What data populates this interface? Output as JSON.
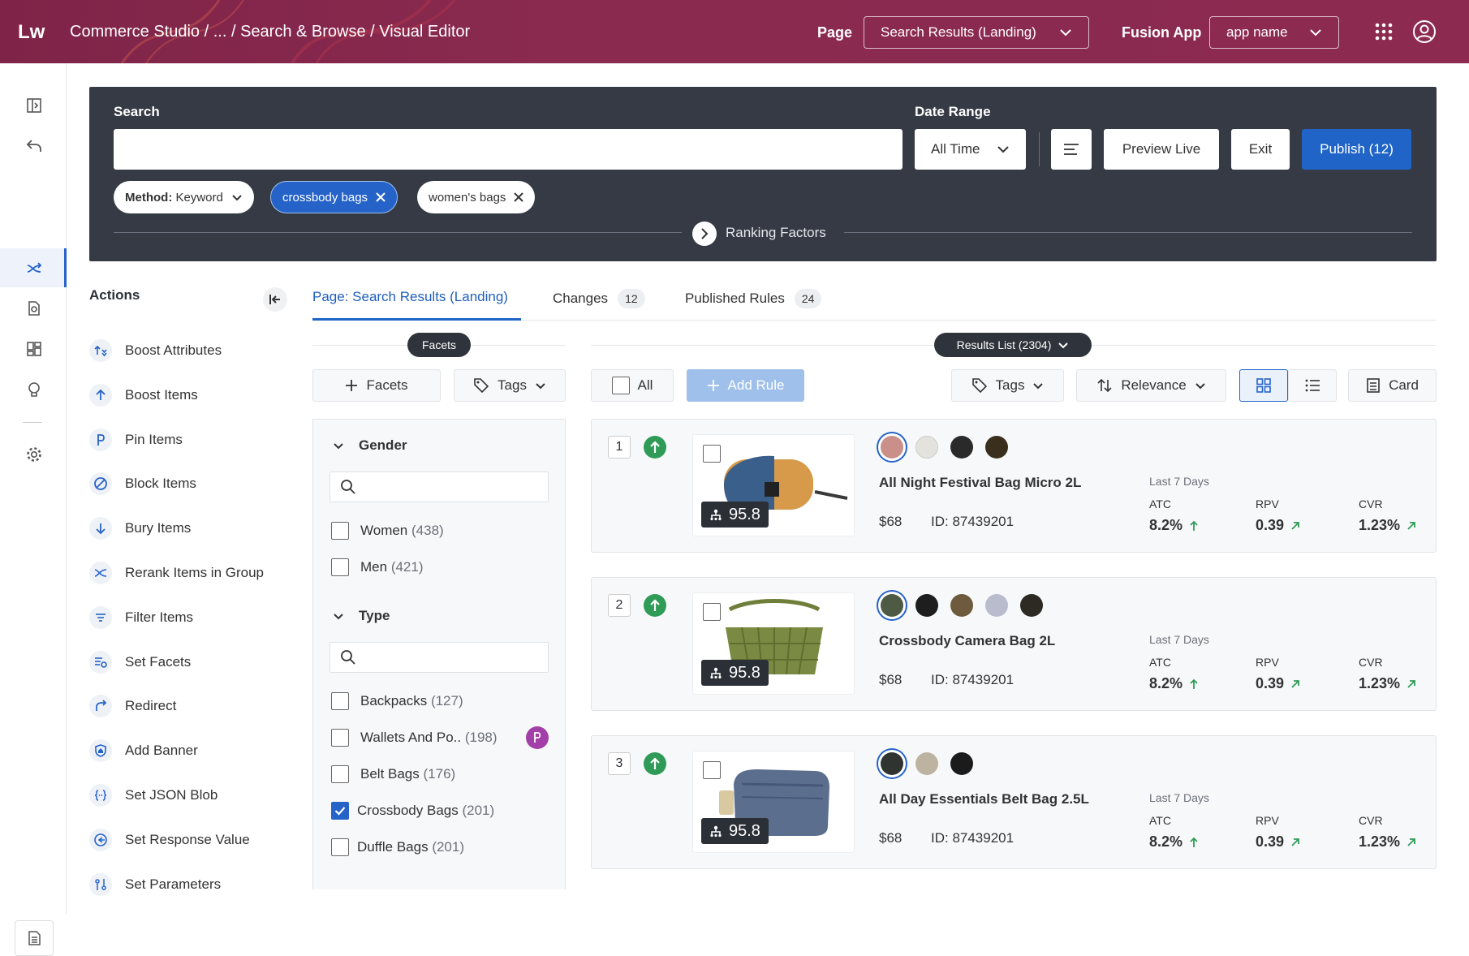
{
  "topbar": {
    "logo": "Lw",
    "breadcrumb": "Commerce Studio / ... / Search & Browse / Visual Editor",
    "page_label": "Page",
    "page_value": "Search Results (Landing)",
    "app_label": "Fusion App",
    "app_value": "app name"
  },
  "panel": {
    "search_label": "Search",
    "search_value": "",
    "date_label": "Date Range",
    "date_value": "All Time",
    "preview_label": "Preview Live",
    "exit_label": "Exit",
    "publish_label": "Publish (12)",
    "chips": {
      "method_key": "Method:",
      "method_value": "Keyword",
      "crossbody": "crossbody bags",
      "womens": "women's bags"
    },
    "ranking_factors": "Ranking Factors"
  },
  "actions": {
    "title": "Actions",
    "items": [
      "Boost Attributes",
      "Boost Items",
      "Pin Items",
      "Block Items",
      "Bury Items",
      "Rerank Items in Group",
      "Filter Items",
      "Set Facets",
      "Redirect",
      "Add Banner",
      "Set JSON Blob",
      "Set Response Value",
      "Set Parameters"
    ]
  },
  "tabs": [
    {
      "label": "Page: Search Results (Landing)"
    },
    {
      "label": "Changes",
      "count": "12"
    },
    {
      "label": "Published Rules",
      "count": "24"
    }
  ],
  "facets_pill": "Facets",
  "results_pill": "Results List (2304)",
  "toolbar": {
    "facets_btn": "Facets",
    "tags_btn": "Tags",
    "all_btn": "All",
    "add_rule_btn": "Add Rule",
    "tags_btn2": "Tags",
    "sort_btn": "Relevance",
    "card_btn": "Card"
  },
  "facets": {
    "gender": {
      "title": "Gender",
      "options": [
        {
          "label": "Women",
          "count": "(438)"
        },
        {
          "label": "Men",
          "count": "(421)"
        }
      ]
    },
    "type": {
      "title": "Type",
      "options": [
        {
          "label": "Backpacks",
          "count": "(127)"
        },
        {
          "label": "Wallets And Po..",
          "count": "(198)"
        },
        {
          "label": "Belt Bags",
          "count": "(176)"
        },
        {
          "label": "Crossbody Bags",
          "count": "(201)"
        },
        {
          "label": "Duffle Bags",
          "count": "(201)"
        }
      ]
    }
  },
  "results": [
    {
      "rank": "1",
      "score": "95.8",
      "name": "All Night Festival Bag Micro 2L",
      "price": "$68",
      "id": "ID: 87439201",
      "period": "Last 7 Days",
      "atc": "8.2%",
      "rpv": "0.39",
      "cvr": "1.23%",
      "colors": [
        "#c98f88",
        "#e4e2dc",
        "#2a2a2a",
        "#3a2f1c"
      ]
    },
    {
      "rank": "2",
      "score": "95.8",
      "name": "Crossbody Camera Bag 2L",
      "price": "$68",
      "id": "ID: 87439201",
      "period": "Last 7 Days",
      "atc": "8.2%",
      "rpv": "0.39",
      "cvr": "1.23%",
      "colors": [
        "#4f5a45",
        "#1e1e1e",
        "#6e5b3d",
        "#b8bccd",
        "#2c2a22"
      ]
    },
    {
      "rank": "3",
      "score": "95.8",
      "name": "All Day Essentials Belt Bag 2.5L",
      "price": "$68",
      "id": "ID: 87439201",
      "period": "Last 7 Days",
      "atc": "8.2%",
      "rpv": "0.39",
      "cvr": "1.23%",
      "colors": [
        "#2f3430",
        "#bdb3a1",
        "#1b1b1b"
      ]
    }
  ],
  "metric_labels": {
    "atc": "ATC",
    "rpv": "RPV",
    "cvr": "CVR"
  }
}
